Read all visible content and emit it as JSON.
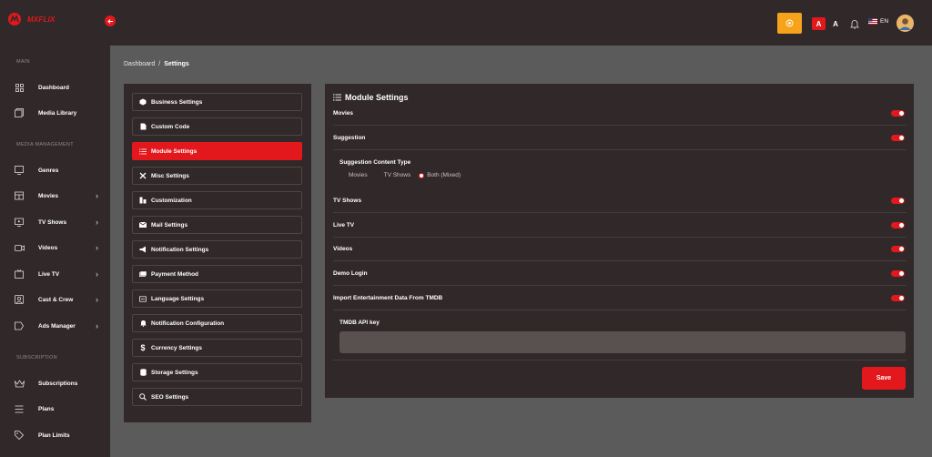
{
  "app": {
    "logo_text": "MXFLIX"
  },
  "sidebar": {
    "sections": {
      "main": "MAIN",
      "media": "MEDIA MANAGEMENT",
      "subscription": "SUBSCRIPTION"
    },
    "items": [
      {
        "label": "Dashboard",
        "icon": "grid-icon"
      },
      {
        "label": "Media Library",
        "icon": "media-library-icon"
      },
      {
        "label": "Genres",
        "icon": "genres-icon"
      },
      {
        "label": "Movies",
        "icon": "movies-icon"
      },
      {
        "label": "TV Shows",
        "icon": "tv-icon"
      },
      {
        "label": "Videos",
        "icon": "video-icon"
      },
      {
        "label": "Live TV",
        "icon": "live-tv-icon"
      },
      {
        "label": "Cast & Crew",
        "icon": "cast-icon"
      },
      {
        "label": "Ads Manager",
        "icon": "ads-icon"
      },
      {
        "label": "Subscriptions",
        "icon": "crown-icon"
      },
      {
        "label": "Plans",
        "icon": "list-icon"
      },
      {
        "label": "Plan Limits",
        "icon": "tag-icon"
      }
    ]
  },
  "header": {
    "font_small": "A",
    "font_large": "A",
    "language": "EN"
  },
  "breadcrumb": {
    "root": "Dashboard",
    "sep": "/",
    "current": "Settings"
  },
  "settings_nav": [
    {
      "label": "Business Settings",
      "icon": "cube-icon"
    },
    {
      "label": "Custom Code",
      "icon": "file-icon"
    },
    {
      "label": "Module Settings",
      "icon": "list-icon"
    },
    {
      "label": "Misc Settings",
      "icon": "tools-icon"
    },
    {
      "label": "Customization",
      "icon": "customization-icon"
    },
    {
      "label": "Mail Settings",
      "icon": "mail-icon"
    },
    {
      "label": "Notification Settings",
      "icon": "megaphone-icon"
    },
    {
      "label": "Payment Method",
      "icon": "payment-icon"
    },
    {
      "label": "Language Settings",
      "icon": "language-icon"
    },
    {
      "label": "Notification Configuration",
      "icon": "bell-icon"
    },
    {
      "label": "Currency Settings",
      "icon": "dollar-icon"
    },
    {
      "label": "Storage Settings",
      "icon": "database-icon"
    },
    {
      "label": "SEO Settings",
      "icon": "search-icon"
    }
  ],
  "module": {
    "title": "Module Settings",
    "toggles": [
      {
        "label": "Movies",
        "on": true
      },
      {
        "label": "Suggestion",
        "on": true
      },
      {
        "label": "TV Shows",
        "on": true
      },
      {
        "label": "Live TV",
        "on": true
      },
      {
        "label": "Videos",
        "on": true
      },
      {
        "label": "Demo Login",
        "on": true
      },
      {
        "label": "Import Entertainment Data From TMDB",
        "on": true
      }
    ],
    "suggestion_type_label": "Suggestion Content Type",
    "suggestion_options": [
      "Movies",
      "TV Shows",
      "Both (Mixed)"
    ],
    "suggestion_selected": "Both (Mixed)",
    "api_key_label": "TMDB API key",
    "api_key_value": "",
    "save_label": "Save"
  },
  "colors": {
    "accent": "#e3181c",
    "panel": "#312829",
    "page": "#5b5b5b",
    "warning": "#f7a21b"
  }
}
